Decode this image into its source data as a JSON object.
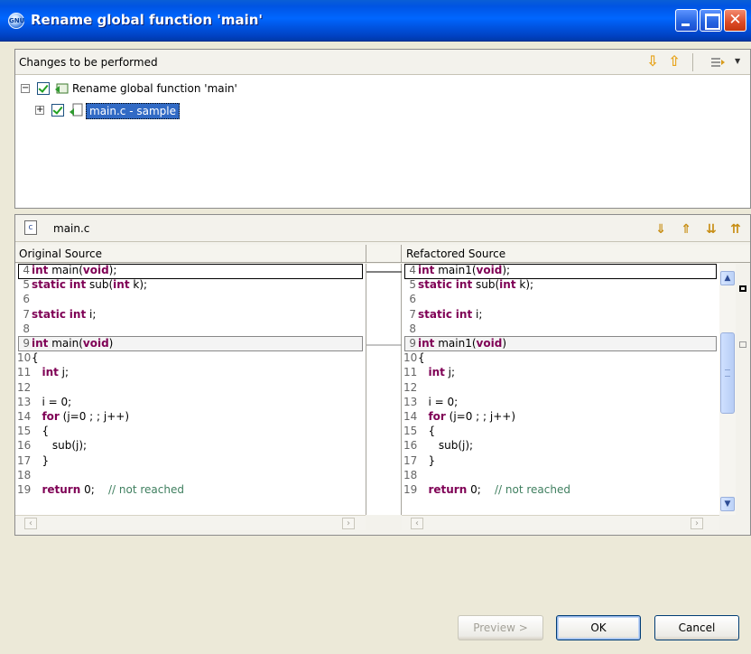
{
  "window": {
    "title": "Rename global function 'main'",
    "icon": "gnu-app-icon"
  },
  "changes": {
    "header": "Changes to be performed",
    "tree": [
      {
        "label": "Rename global function 'main'",
        "checked": true,
        "expanded": true,
        "icon": "rename-change-icon"
      },
      {
        "label": "main.c - sample",
        "checked": true,
        "expanded": false,
        "selected": true,
        "icon": "file-change-icon"
      }
    ]
  },
  "source": {
    "file": "main.c",
    "left_title": "Original Source",
    "right_title": "Refactored Source",
    "left_lines": [
      {
        "n": "4",
        "parts": [
          {
            "t": "int",
            "k": true
          },
          {
            "t": " main("
          },
          {
            "t": "void",
            "k": true
          },
          {
            "t": ");"
          }
        ]
      },
      {
        "n": "5",
        "parts": [
          {
            "t": "static",
            "k": true
          },
          {
            "t": " "
          },
          {
            "t": "int",
            "k": true
          },
          {
            "t": " sub("
          },
          {
            "t": "int",
            "k": true
          },
          {
            "t": " k);"
          }
        ]
      },
      {
        "n": "6",
        "parts": []
      },
      {
        "n": "7",
        "parts": [
          {
            "t": "static",
            "k": true
          },
          {
            "t": " "
          },
          {
            "t": "int",
            "k": true
          },
          {
            "t": " i;"
          }
        ]
      },
      {
        "n": "8",
        "parts": []
      },
      {
        "n": "9",
        "parts": [
          {
            "t": "int",
            "k": true
          },
          {
            "t": " main("
          },
          {
            "t": "void",
            "k": true
          },
          {
            "t": ")"
          }
        ]
      },
      {
        "n": "10",
        "parts": [
          {
            "t": "{"
          }
        ]
      },
      {
        "n": "11",
        "parts": [
          {
            "t": "   "
          },
          {
            "t": "int",
            "k": true
          },
          {
            "t": " j;"
          }
        ]
      },
      {
        "n": "12",
        "parts": []
      },
      {
        "n": "13",
        "parts": [
          {
            "t": "   i = 0;"
          }
        ]
      },
      {
        "n": "14",
        "parts": [
          {
            "t": "   "
          },
          {
            "t": "for",
            "k": true
          },
          {
            "t": " (j=0 ; ; j++)"
          }
        ]
      },
      {
        "n": "15",
        "parts": [
          {
            "t": "   {"
          }
        ]
      },
      {
        "n": "16",
        "parts": [
          {
            "t": "      sub(j);"
          }
        ]
      },
      {
        "n": "17",
        "parts": [
          {
            "t": "   }"
          }
        ]
      },
      {
        "n": "18",
        "parts": []
      },
      {
        "n": "19",
        "parts": [
          {
            "t": "   "
          },
          {
            "t": "return",
            "k": true
          },
          {
            "t": " 0;    "
          },
          {
            "t": "// not reached",
            "c": true
          }
        ]
      }
    ],
    "right_lines": [
      {
        "n": "4",
        "parts": [
          {
            "t": "int",
            "k": true
          },
          {
            "t": " main1("
          },
          {
            "t": "void",
            "k": true
          },
          {
            "t": ");"
          }
        ]
      },
      {
        "n": "5",
        "parts": [
          {
            "t": "static",
            "k": true
          },
          {
            "t": " "
          },
          {
            "t": "int",
            "k": true
          },
          {
            "t": " sub("
          },
          {
            "t": "int",
            "k": true
          },
          {
            "t": " k);"
          }
        ]
      },
      {
        "n": "6",
        "parts": []
      },
      {
        "n": "7",
        "parts": [
          {
            "t": "static",
            "k": true
          },
          {
            "t": " "
          },
          {
            "t": "int",
            "k": true
          },
          {
            "t": " i;"
          }
        ]
      },
      {
        "n": "8",
        "parts": []
      },
      {
        "n": "9",
        "parts": [
          {
            "t": "int",
            "k": true
          },
          {
            "t": " main1("
          },
          {
            "t": "void",
            "k": true
          },
          {
            "t": ")"
          }
        ]
      },
      {
        "n": "10",
        "parts": [
          {
            "t": "{"
          }
        ]
      },
      {
        "n": "11",
        "parts": [
          {
            "t": "   "
          },
          {
            "t": "int",
            "k": true
          },
          {
            "t": " j;"
          }
        ]
      },
      {
        "n": "12",
        "parts": []
      },
      {
        "n": "13",
        "parts": [
          {
            "t": "   i = 0;"
          }
        ]
      },
      {
        "n": "14",
        "parts": [
          {
            "t": "   "
          },
          {
            "t": "for",
            "k": true
          },
          {
            "t": " (j=0 ; ; j++)"
          }
        ]
      },
      {
        "n": "15",
        "parts": [
          {
            "t": "   {"
          }
        ]
      },
      {
        "n": "16",
        "parts": [
          {
            "t": "      sub(j);"
          }
        ]
      },
      {
        "n": "17",
        "parts": [
          {
            "t": "   }"
          }
        ]
      },
      {
        "n": "18",
        "parts": []
      },
      {
        "n": "19",
        "parts": [
          {
            "t": "   "
          },
          {
            "t": "return",
            "k": true
          },
          {
            "t": " 0;    "
          },
          {
            "t": "// not reached",
            "c": true
          }
        ]
      }
    ]
  },
  "buttons": {
    "preview": "Preview >",
    "ok": "OK",
    "cancel": "Cancel"
  }
}
